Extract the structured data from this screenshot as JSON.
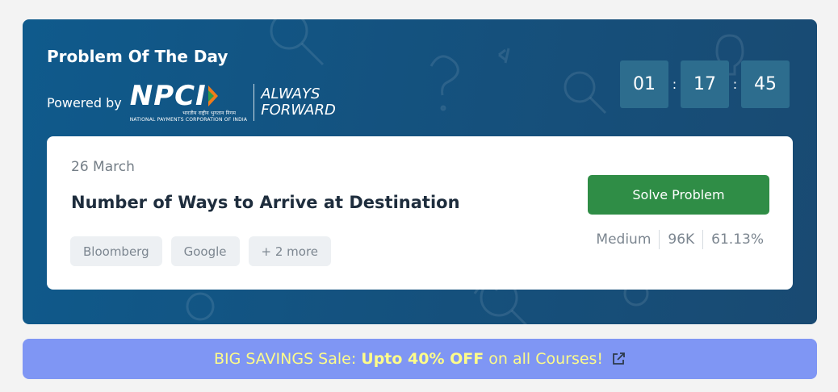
{
  "banner": {
    "title": "Problem Of The Day",
    "powered_by": "Powered by",
    "logo": {
      "brand": "NPCI",
      "hindi_name": "भारतीय राष्ट्रीय भुगतान निगम",
      "english_name": "NATIONAL PAYMENTS CORPORATION OF INDIA",
      "tagline_line1": "ALWAYS",
      "tagline_line2": "FORWARD"
    },
    "timer": {
      "hours": "01",
      "minutes": "17",
      "seconds": "45",
      "separator": ":"
    }
  },
  "problem": {
    "date": "26 March",
    "title": "Number of Ways to Arrive at Destination",
    "tags": [
      "Bloomberg",
      "Google",
      "+ 2 more"
    ],
    "solve_label": "Solve Problem",
    "difficulty": "Medium",
    "submissions": "96K",
    "accuracy": "61.13%"
  },
  "sale": {
    "prefix": "BIG SAVINGS Sale:",
    "highlight": "Upto 40% OFF",
    "suffix": "on all Courses!",
    "icon": "external-link-icon"
  },
  "colors": {
    "banner_bg": "#14527f",
    "solve_button": "#2f8d46",
    "sale_bg": "#7f96f4",
    "sale_text": "#fdfb8a"
  }
}
